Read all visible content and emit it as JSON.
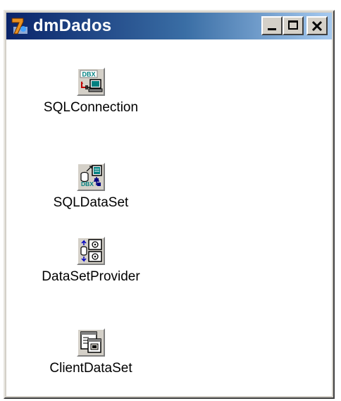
{
  "window": {
    "title": "dmDados"
  },
  "components": [
    {
      "label": "SQLConnection",
      "icon": "dbx-connection-icon"
    },
    {
      "label": "SQLDataSet",
      "icon": "dbx-dataset-icon"
    },
    {
      "label": "DataSetProvider",
      "icon": "dataset-provider-icon"
    },
    {
      "label": "ClientDataSet",
      "icon": "client-dataset-icon"
    }
  ],
  "icon_text": {
    "dbx": "DBX"
  },
  "colors": {
    "titlebar_start": "#0a246a",
    "titlebar_end": "#a6caf0",
    "face": "#d4d0c8",
    "dbx_label": "#008080"
  }
}
